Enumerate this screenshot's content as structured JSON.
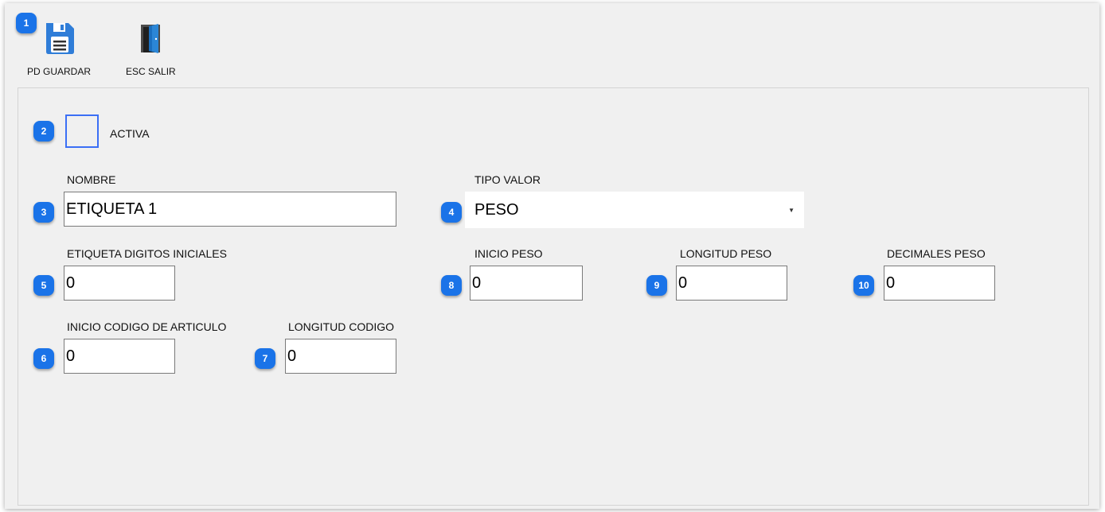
{
  "toolbar": {
    "save_label": "PD GUARDAR",
    "exit_label": "ESC SALIR"
  },
  "badges": [
    "1",
    "2",
    "3",
    "4",
    "5",
    "6",
    "7",
    "8",
    "9",
    "10"
  ],
  "form": {
    "activa_label": "ACTIVA",
    "activa_checked": false,
    "nombre_label": "NOMBRE",
    "nombre_value": "ETIQUETA 1",
    "tipo_valor_label": "TIPO VALOR",
    "tipo_valor_value": "PESO",
    "etiqueta_digitos_label": "ETIQUETA DIGITOS INICIALES",
    "etiqueta_digitos_value": "0",
    "inicio_codigo_label": "INICIO CODIGO DE ARTICULO",
    "inicio_codigo_value": "0",
    "longitud_codigo_label": "LONGITUD CODIGO",
    "longitud_codigo_value": "0",
    "inicio_peso_label": "INICIO PESO",
    "inicio_peso_value": "0",
    "longitud_peso_label": "LONGITUD PESO",
    "longitud_peso_value": "0",
    "decimales_peso_label": "DECIMALES PESO",
    "decimales_peso_value": "0"
  },
  "colors": {
    "badge": "#1a73e8",
    "checkbox_border": "#3b6ff5",
    "background": "#f0f0f0"
  },
  "icons": {
    "save": "floppy-disk-icon",
    "exit": "door-exit-icon"
  }
}
